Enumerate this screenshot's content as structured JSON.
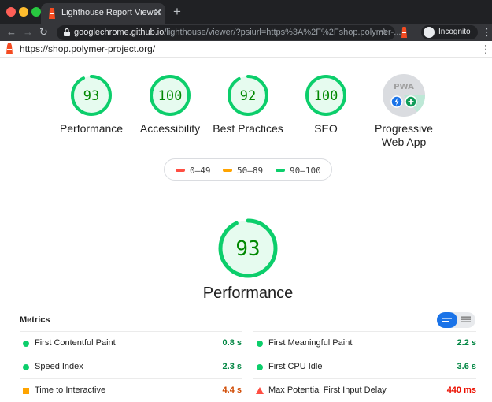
{
  "browser": {
    "tab_title": "Lighthouse Report Viewer",
    "tab_close": "✕",
    "new_tab": "+",
    "url_host": "googlechrome.github.io",
    "url_path": "/lighthouse/viewer/?psiurl=https%3A%2F%2Fshop.polymer-...",
    "incognito_label": "Incognito"
  },
  "report": {
    "url": "https://shop.polymer-project.org/",
    "categories": [
      {
        "score": "93",
        "label": "Performance"
      },
      {
        "score": "100",
        "label": "Accessibility"
      },
      {
        "score": "92",
        "label": "Best Practices"
      },
      {
        "score": "100",
        "label": "SEO"
      }
    ],
    "pwa": {
      "label_line1": "Progressive",
      "label_line2": "Web App",
      "badge_text": "PWA"
    },
    "legend": [
      {
        "range": "0–49",
        "color": "#ff4e42"
      },
      {
        "range": "50–89",
        "color": "#ffa400"
      },
      {
        "range": "90–100",
        "color": "#0cce6b"
      }
    ],
    "performance": {
      "score": "93",
      "title": "Performance"
    },
    "metrics_title": "Metrics",
    "metrics": [
      {
        "name": "First Contentful Paint",
        "value": "0.8 s",
        "status": "pass"
      },
      {
        "name": "First Meaningful Paint",
        "value": "2.2 s",
        "status": "pass"
      },
      {
        "name": "Speed Index",
        "value": "2.3 s",
        "status": "pass"
      },
      {
        "name": "First CPU Idle",
        "value": "3.6 s",
        "status": "pass"
      },
      {
        "name": "Time to Interactive",
        "value": "4.4 s",
        "status": "average"
      },
      {
        "name": "Max Potential First Input Delay",
        "value": "440 ms",
        "status": "fail"
      }
    ]
  },
  "colors": {
    "pass": "#0cce6b",
    "average": "#ffa400",
    "fail": "#ff4e42"
  }
}
